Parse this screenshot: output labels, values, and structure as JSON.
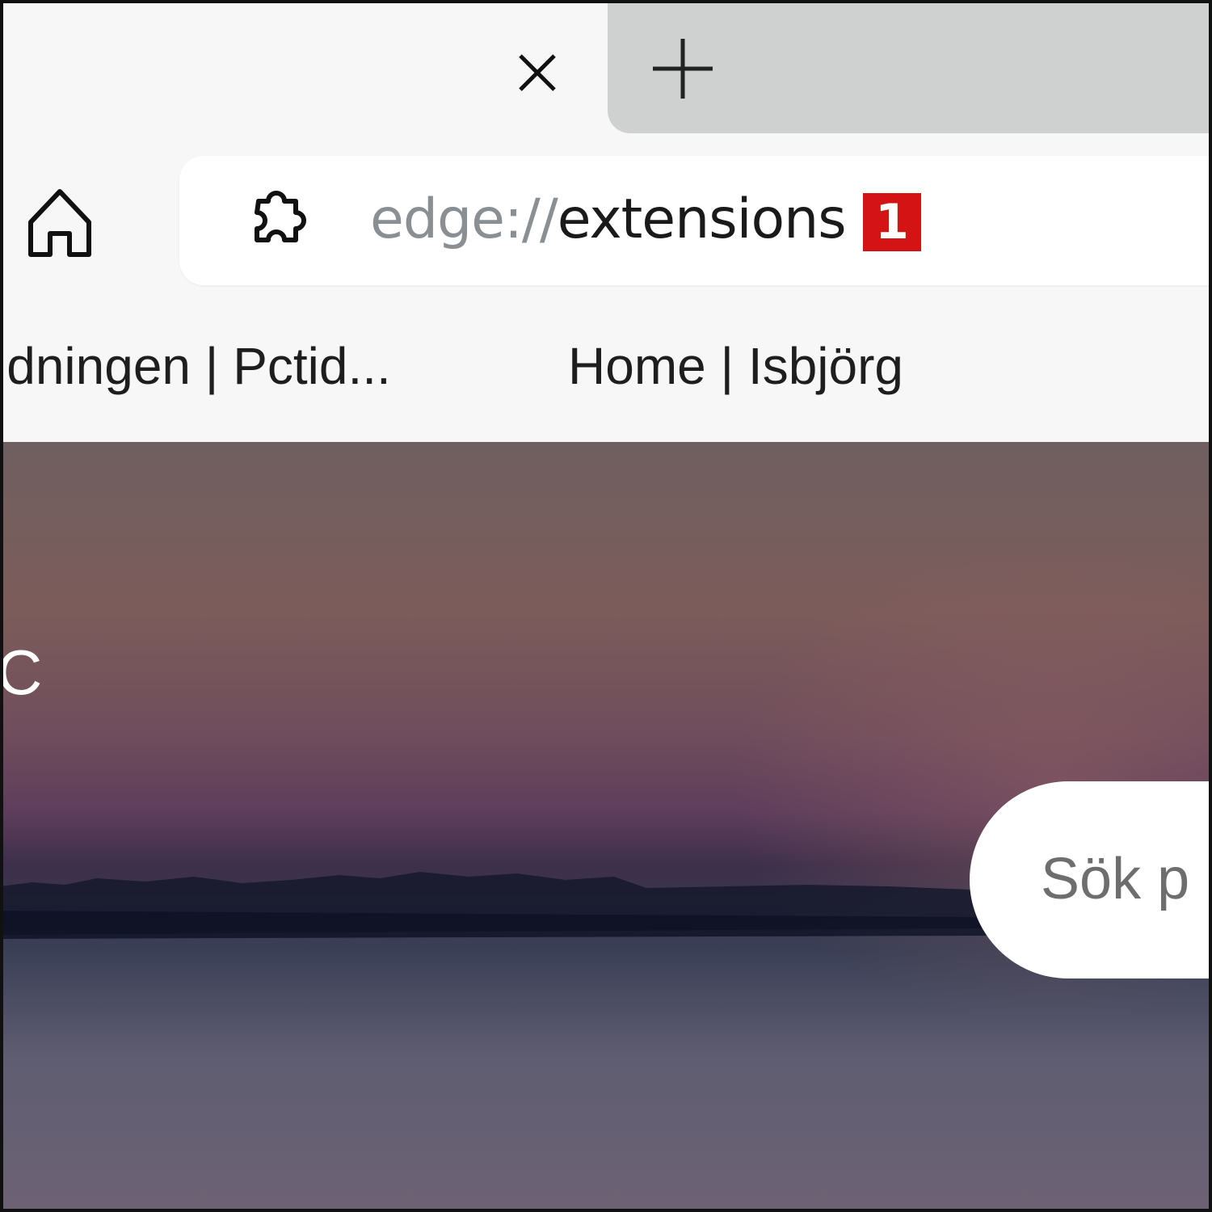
{
  "tabs": {
    "close_icon": "close-icon",
    "new_tab_icon": "plus-icon"
  },
  "toolbar": {
    "home_icon": "home-icon",
    "extension_icon": "puzzle-icon",
    "address": {
      "scheme": "edge://",
      "path": "extensions"
    },
    "badge": "1"
  },
  "favorites": [
    {
      "label": "idningen | Pctid..."
    },
    {
      "label": "Home | Isbjörg"
    }
  ],
  "page": {
    "greeting_fragment": "C",
    "search_placeholder": "Sök p"
  },
  "colors": {
    "badge_bg": "#d41414",
    "inactive_tab_bg": "#cfd0d0",
    "chrome_bg": "#f6f7f6"
  }
}
